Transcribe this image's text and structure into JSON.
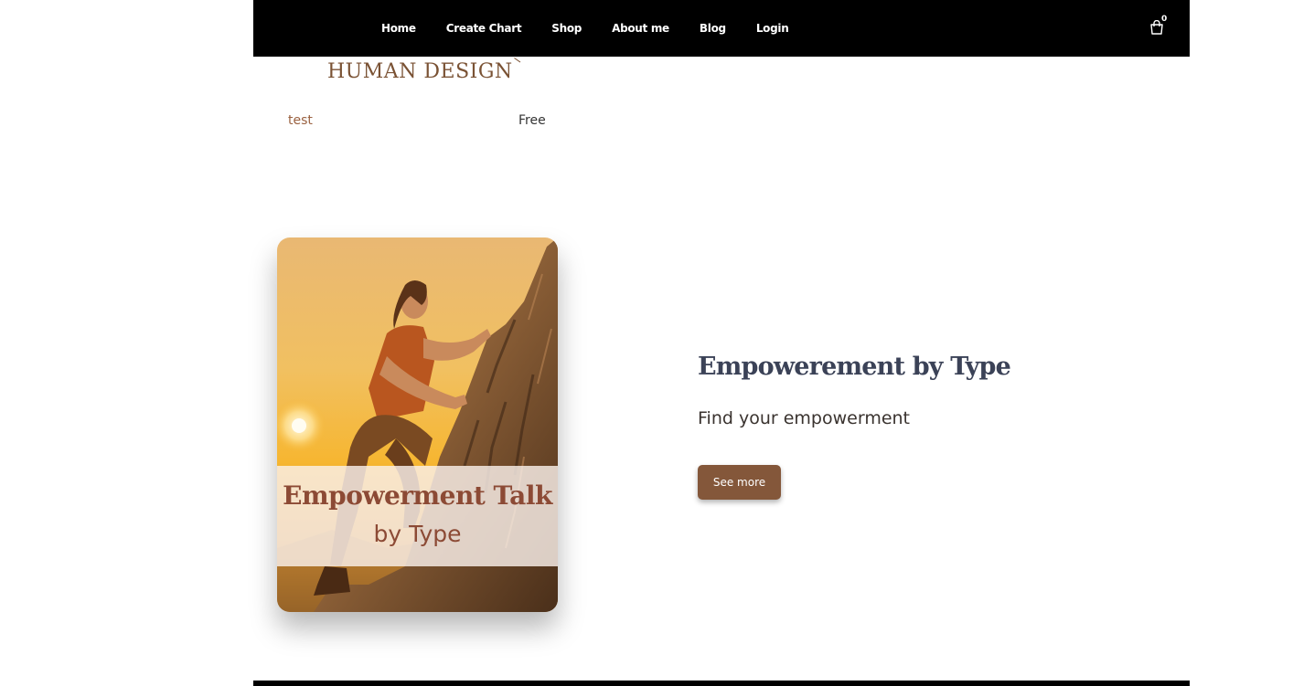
{
  "nav": {
    "items": [
      {
        "label": "Home"
      },
      {
        "label": "Create Chart"
      },
      {
        "label": "Shop"
      },
      {
        "label": "About me"
      },
      {
        "label": "Blog"
      },
      {
        "label": "Login"
      }
    ],
    "cart_icon": "shopping-bag-icon",
    "cart_count": "0"
  },
  "logo": {
    "text": "HUMAN DESIGN"
  },
  "product": {
    "name": "test",
    "price": "Free"
  },
  "card": {
    "image": "woman-climbing-rock-at-sunset",
    "title": "Empowerment Talk",
    "subtitle": "by Type"
  },
  "feature": {
    "headline": "Empowerement by Type",
    "description": "Find your empowerment",
    "button_label": "See more"
  },
  "colors": {
    "nav_background": "#000000",
    "brand_brown": "#84573a",
    "headline": "#3b4257",
    "product_link": "#9a6140"
  }
}
